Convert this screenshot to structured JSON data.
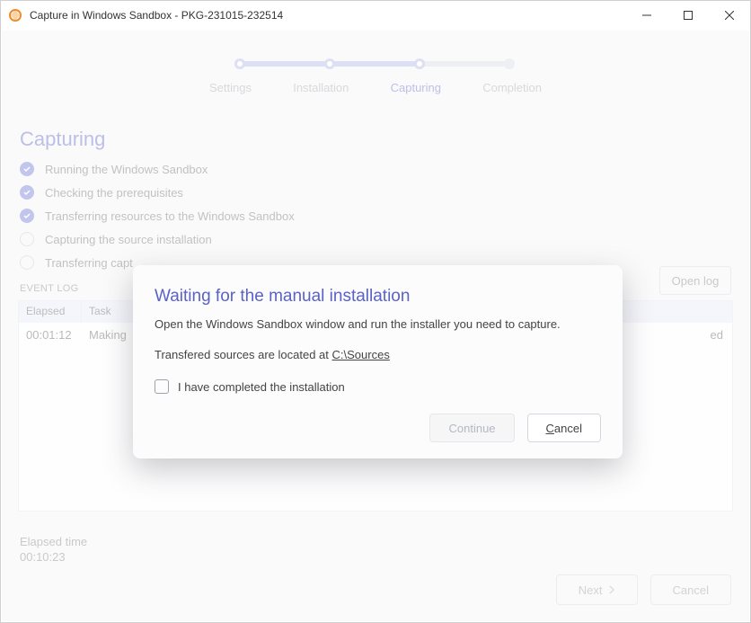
{
  "window": {
    "title": "Capture in Windows Sandbox - PKG-231015-232514"
  },
  "stepper": {
    "steps": [
      "Settings",
      "Installation",
      "Capturing",
      "Completion"
    ],
    "active_index": 2
  },
  "section": {
    "title": "Capturing"
  },
  "checklist": [
    {
      "label": "Running the Windows Sandbox",
      "done": true
    },
    {
      "label": "Checking the prerequisites",
      "done": true
    },
    {
      "label": "Transferring resources to the Windows Sandbox",
      "done": true
    },
    {
      "label": "Capturing the source installation",
      "done": false
    },
    {
      "label": "Transferring capt",
      "done": false
    }
  ],
  "event_log": {
    "title": "EVENT LOG",
    "open_log_label": "Open log",
    "columns": {
      "elapsed": "Elapsed",
      "task": "Task"
    },
    "rows": [
      {
        "elapsed": "00:01:12",
        "task": "Making",
        "status_tail": "ed"
      }
    ]
  },
  "footer": {
    "elapsed_label": "Elapsed time",
    "elapsed_value": "00:10:23",
    "next_label": "Next",
    "cancel_label": "Cancel"
  },
  "modal": {
    "title": "Waiting for the manual installation",
    "body": "Open the Windows Sandbox window and run the installer you need to capture.",
    "sources_prefix": "Transfered sources are located at ",
    "sources_path": "C:\\Sources",
    "checkbox_label": "I have completed the installation",
    "checkbox_checked": false,
    "continue_label": "Continue",
    "cancel_label": "Cancel"
  }
}
